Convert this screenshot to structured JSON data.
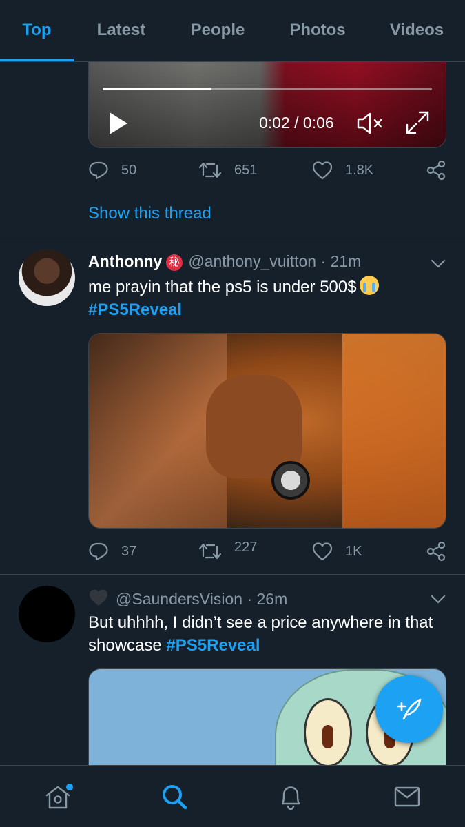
{
  "tabs": [
    {
      "label": "Top",
      "active": true
    },
    {
      "label": "Latest"
    },
    {
      "label": "People"
    },
    {
      "label": "Photos"
    },
    {
      "label": "Videos"
    }
  ],
  "video_tweet": {
    "time": "0:02 / 0:06",
    "progress": 0.33,
    "replies": "50",
    "retweets": "651",
    "likes": "1.8K",
    "show_thread": "Show this thread"
  },
  "tweet1": {
    "name": "Anthonny",
    "badge": "秘",
    "handle": "@anthony_vuitton",
    "time": "· 21m",
    "text": "me prayin that the ps5 is under 500$",
    "hashtag": "#PS5Reveal",
    "replies": "37",
    "retweets": "227",
    "likes": "1K"
  },
  "tweet2": {
    "handle": "@SaundersVision",
    "time": "· 26m",
    "text": "But uhhhh, I didn’t see a price anywhere in that showcase",
    "hashtag": "#PS5Reveal"
  },
  "colors": {
    "background": "#15202b",
    "accent": "#1da1f2",
    "muted": "#8899a6",
    "border": "#38444d"
  },
  "icons": {
    "reply": "reply-icon",
    "retweet": "retweet-icon",
    "like": "heart-icon",
    "share": "share-icon",
    "compose": "compose-icon",
    "home": "home-icon",
    "search": "search-icon",
    "notifications": "bell-icon",
    "messages": "mail-icon"
  }
}
